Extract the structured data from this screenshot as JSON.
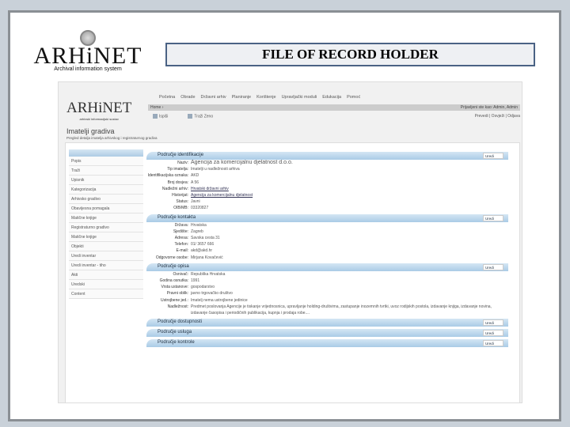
{
  "slide": {
    "logo_text": "ARHiNET",
    "logo_sub": "Archival information system",
    "title": "FILE OF RECORD HOLDER"
  },
  "app": {
    "logo_text": "ARHiNET",
    "logo_sub": "arhivski informacijski sustav",
    "nav": [
      "Početna",
      "Obrade",
      "Državni arhiv",
      "Planiranje",
      "Korištenje",
      "Upravljački moduli",
      "Edukacija",
      "Pomoć"
    ],
    "breadcrumb": "Home ›",
    "user": "Prijavljeni ste kao: Admin, Admin",
    "tools": [
      "Ispiši",
      "Traži Zeno"
    ],
    "tools_right": "Prevedi | Osvježi | Odjava",
    "page_title": "Imatelji gradiva",
    "page_sub": "Pregled detalja imatelja arhivskog i registraturnog gradiva",
    "sidebar": [
      "Popis",
      "Traži",
      "Upisnik",
      "Kategorizacija",
      "Arhivsko gradivo",
      "Obavijesna pomagala",
      "Matične knjige",
      "Registraturno gradivo",
      "Matične knjige",
      "Objekti",
      "Uredi inventar",
      "Uredi inventar - tiho",
      "Akti",
      "Uredski",
      "Content"
    ],
    "edit_label": "Uredi",
    "sections": [
      {
        "title": "Područje identifikacije",
        "rows": [
          {
            "l": "Naziv:",
            "v": "Agencija za komercijalnu djelatnost d.o.o."
          },
          {
            "l": "Tip imatelja:",
            "v": "Imatelji u nadležnosti arhiva"
          },
          {
            "l": "Identifikacijska oznaka:",
            "v": "AKD"
          },
          {
            "l": "Broj dosjea:",
            "v": "A 56"
          },
          {
            "l": "Nadležni arhiv:",
            "v": "Hrvatski državni arhiv"
          },
          {
            "l": "Historijat:",
            "v": "Agencija za komercijalnu djelatnost"
          },
          {
            "l": "Status:",
            "v": "Javni"
          },
          {
            "l": "OIB/MB:",
            "v": "03320827"
          }
        ]
      },
      {
        "title": "Područje kontakta",
        "rows": [
          {
            "l": "Država:",
            "v": "Hrvatska"
          },
          {
            "l": "Sjedište:",
            "v": "Zagreb"
          },
          {
            "l": "Adresa:",
            "v": "Savska cesta 31"
          },
          {
            "l": "Telefon:",
            "v": "01/ 3657 666"
          },
          {
            "l": "E-mail:",
            "v": "akd@akd.hr"
          },
          {
            "l": "Odgovorne osobe:",
            "v": "Mirjana Kovačević"
          }
        ]
      },
      {
        "title": "Područje opisa",
        "rows": [
          {
            "l": "Osnivač:",
            "v": "Republika Hrvatska"
          },
          {
            "l": "Godina osnutka:",
            "v": "1991"
          },
          {
            "l": "Vrsta ustanove:",
            "v": "gospodarstvo"
          },
          {
            "l": "Pravni oblik:",
            "v": "javno trgovačko društvo"
          },
          {
            "l": "Ustrojbene jed.:",
            "v": "Imatelj nema ustrojbene jedinice"
          },
          {
            "l": "Nadležnost:",
            "v": "Predmet poslovanja Agencije je tiskanje vrijednosnica, upravljanje holding-društvima, zastupanje inozemnih tvrtki, uvoz rodijskih postola, izdavanje knjiga, izdavanje novina, izdavanje časopisa i periodičnih publikacija, kupnja i prodaja robe...."
          }
        ]
      },
      {
        "title": "Područje dostupnosti",
        "rows": []
      },
      {
        "title": "Područje usluga",
        "rows": []
      },
      {
        "title": "Područje kontrole",
        "rows": []
      }
    ]
  }
}
